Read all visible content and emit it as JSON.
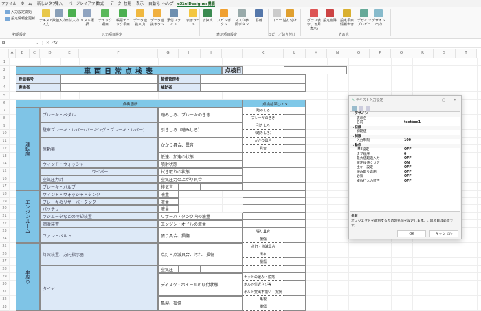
{
  "menu_tabs": [
    "ファイル",
    "ホーム",
    "新しいタブ",
    "挿入",
    "ページレイアウト",
    "数式",
    "データ",
    "校閲",
    "表示",
    "自動化",
    "ヘルプ",
    "eXtelDesigner機能"
  ],
  "ribbon": {
    "init_items": [
      "入力設定開始",
      "設定情報全更新"
    ],
    "buttons": [
      "テキスト入力",
      "数値入力",
      "日付入力",
      "リスト選択",
      "チェック項目",
      "帳票チェック項目",
      "データ連携入力",
      "データ連携ボタン",
      "添付ファイル",
      "表示ラベル",
      "計算式",
      "スピンボタン",
      "マスク参照ボタン",
      "罫線",
      "コピー",
      "貼り付け",
      "グラフ表示(1ヵ月表示)",
      "設定削除",
      "設定項目情報表示",
      "デザインプレビュー",
      "デザイン出力"
    ],
    "groups": [
      "初期設定",
      "入力項目設定",
      "表示項目設定",
      "コピー／貼り付け",
      "その他"
    ]
  },
  "formula_bar": {
    "name_box": "I3",
    "fx": "fx",
    "value": ""
  },
  "columns": [
    "A",
    "B",
    "C",
    "D",
    "E",
    "F",
    "G",
    "H",
    "I",
    "J",
    "K",
    "L",
    "M",
    "N",
    "O",
    "P",
    "Q",
    "R",
    "S",
    "T"
  ],
  "sheet": {
    "title": "車両日常点検表",
    "date_label": "点検日",
    "reg_no_label": "登録番号",
    "manager_label": "整備管理者",
    "inspector_label": "実施者",
    "assistant_label": "補助者",
    "header_place": "点検箇所",
    "header_result": "点検結果○・×",
    "categories": [
      "運転席",
      "エンジンルーム",
      "車周り"
    ],
    "items": [
      "ブレーキ・ペダル",
      "駐車ブレーキ・レバー(パーキング・ブレーキ・レバー)",
      "原動機",
      "ウィンド・ウォッシャ",
      "ワイパー",
      "空気圧力計",
      "ブレーキ・バルブ",
      "ウィンド・ウォッシャ・タンク",
      "ブレーキのリザーバ・タンク",
      "バッテリ",
      "ラジエータなどの冷却装置",
      "潤滑装置",
      "ファン・ベルト",
      "灯火装置、方向指示器",
      "タイヤ"
    ],
    "checks": [
      "踏みしろ、ブレーキのきき",
      "引きしろ（踏みしろ）",
      "かかり具合、異音",
      "低速、加速の状態",
      "噴射状態",
      "拭き取りの状態",
      "空気圧力の上がり具合",
      "排気音",
      "液量",
      "液量",
      "液量",
      "リザーバ・タンク内の液量",
      "エンジン・オイルの液量",
      "張り具合、損傷",
      "点灯・点滅具合、汚れ、損傷",
      "空気圧",
      "ディスク・ホイールの取付状態",
      "亀裂、損傷"
    ],
    "results": [
      "踏みしろ",
      "ブレーキのきき",
      "引きしろ",
      "（踏みしろ）",
      "かかり具合",
      "異音",
      "張り具合",
      "損傷",
      "点灯・点滅具合",
      "汚れ",
      "損傷",
      "ナットの緩み・脱落",
      "ボルト付近さび等",
      "ボルト突出不揃い・折損",
      "亀裂",
      "損傷"
    ]
  },
  "dialog": {
    "title": "テキスト入力設定",
    "minimize": "—",
    "maximize": "▢",
    "close": "✕",
    "properties": [
      {
        "cat": "デザイン",
        "rows": [
          [
            "表示名",
            ""
          ],
          [
            "名前",
            "textbox1"
          ]
        ]
      },
      {
        "cat": "記録",
        "rows": [
          [
            "初期値",
            ""
          ]
        ]
      },
      {
        "cat": "制限",
        "rows": [
          [
            "入力制限",
            "100"
          ]
        ]
      },
      {
        "cat": "動作",
        "rows": [
          [
            "IME設定",
            "OFF"
          ],
          [
            "タブ順序",
            "0"
          ],
          [
            "最大値超過入力",
            "OFF"
          ],
          [
            "確定後値クリア",
            "ON"
          ],
          [
            "主キー設定",
            "OFF"
          ],
          [
            "読み取り専用",
            "OFF"
          ],
          [
            "必須",
            "OFF"
          ],
          [
            "複数行入力可否",
            "OFF"
          ]
        ]
      }
    ],
    "desc_title": "名前",
    "desc_text": "オブジェクトを識別するための名前を設定します。この項目は必須です。",
    "ok": "OK",
    "cancel": "キャンセル"
  },
  "colors": {
    "header_blue": "#7fc8e8",
    "label_blue": "#dde9f7",
    "category_blue": "#7fc4e6"
  }
}
